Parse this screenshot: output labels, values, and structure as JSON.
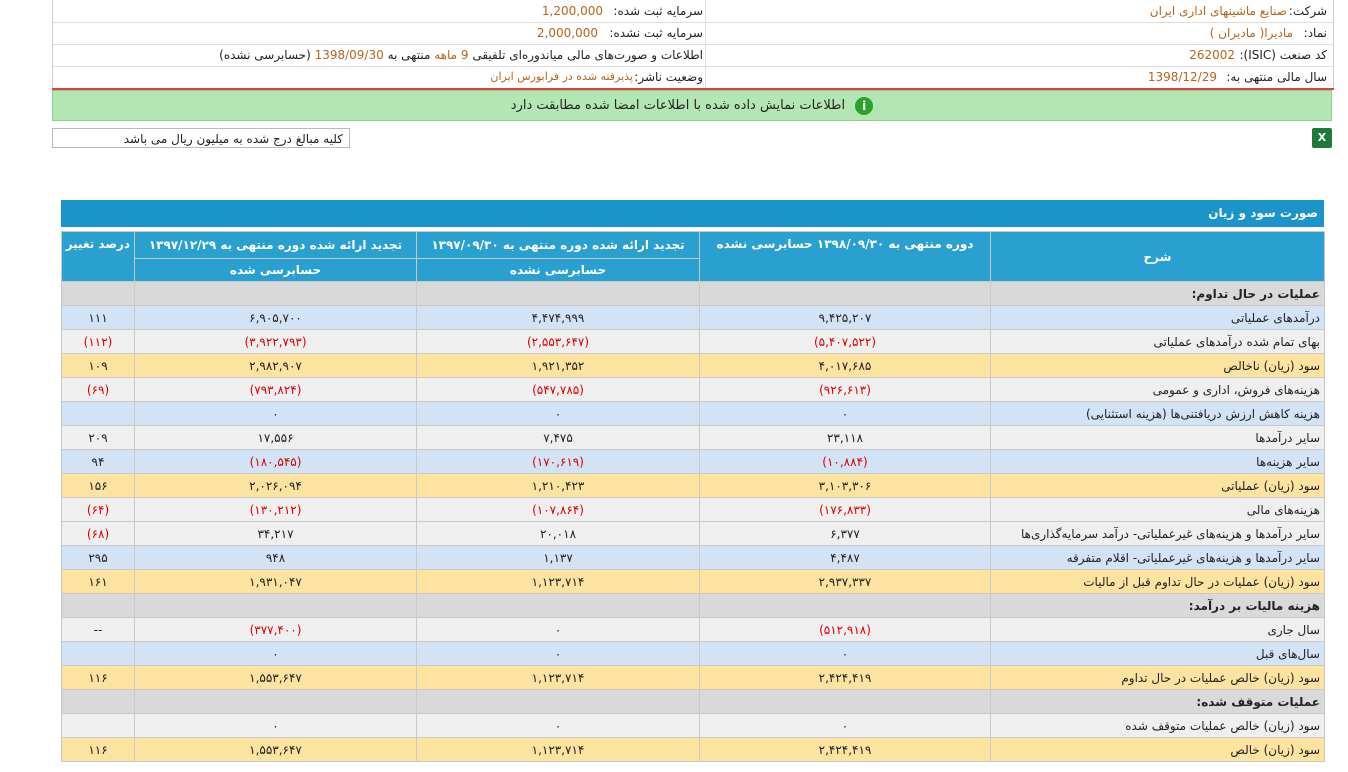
{
  "company": {
    "company_label": "شرکت:",
    "company_value": "صنایع ماشینهای اداری ایران",
    "registered_capital_label": "سرمایه ثبت شده:",
    "registered_capital_value": "1,200,000",
    "symbol_label": "نماد:",
    "symbol_value": "مادیرا( مادیران )",
    "unregistered_capital_label": "سرمایه ثبت نشده:",
    "unregistered_capital_value": "2,000,000",
    "isic_label": "کد صنعت (ISIC):",
    "isic_value": "262002",
    "report_desc_prefix": "اطلاعات و صورت‌های مالی میاندوره‌ای تلفیقی",
    "report_months": "9 ماهه",
    "report_ending": "منتهی به",
    "report_date": "1398/09/30",
    "report_status": "(حسابرسی نشده)",
    "fiscal_year_label": "سال مالی منتهی به:",
    "fiscal_year_value": "1398/12/29",
    "publisher_status_label": "وضعیت ناشر:",
    "publisher_status_value": "پذیرفته شده در فرابورس ایران"
  },
  "notice": {
    "text": "اطلاعات نمایش داده شده با اطلاعات امضا شده مطابقت دارد",
    "icon": "info-icon"
  },
  "amount_note": "کلیه مبالغ درج شده به میلیون ریال می باشد",
  "excel_icon": "excel-icon",
  "table": {
    "title": "صورت سود و زیان",
    "headers": {
      "desc": "شرح",
      "col1_top": "دوره منتهی به ۱۳۹۸/۰۹/۳۰ حسابرسی نشده",
      "col2_top": "تجدید ارائه شده دوره منتهی به ۱۳۹۷/۰۹/۳۰",
      "col2_bottom": "حسابرسی نشده",
      "col3_top": "تجدید ارائه شده دوره منتهی به ۱۳۹۷/۱۲/۲۹",
      "col3_bottom": "حسابرسی شده",
      "col4": "درصد تغییر"
    },
    "rows": [
      {
        "style": "section",
        "desc": "عملیات در حال تداوم:",
        "c1": "",
        "c2": "",
        "c3": "",
        "c4": ""
      },
      {
        "style": "blue",
        "desc": "درآمدهای عملیاتی",
        "c1": "۹,۴۲۵,۲۰۷",
        "c2": "۴,۴۷۴,۹۹۹",
        "c3": "۶,۹۰۵,۷۰۰",
        "c4": "۱۱۱"
      },
      {
        "style": "white",
        "desc": "بهای تمام شده درآمدهای عملیاتی",
        "c1": "(۵,۴۰۷,۵۲۲)",
        "c2": "(۲,۵۵۳,۶۴۷)",
        "c3": "(۳,۹۲۲,۷۹۳)",
        "c4": "(۱۱۲)"
      },
      {
        "style": "orange",
        "desc": "سود (زیان) ناخالص",
        "c1": "۴,۰۱۷,۶۸۵",
        "c2": "۱,۹۲۱,۳۵۲",
        "c3": "۲,۹۸۲,۹۰۷",
        "c4": "۱۰۹"
      },
      {
        "style": "white",
        "desc": "هزینه‌های فروش، اداری و عمومی",
        "c1": "(۹۲۶,۶۱۳)",
        "c2": "(۵۴۷,۷۸۵)",
        "c3": "(۷۹۳,۸۲۴)",
        "c4": "(۶۹)"
      },
      {
        "style": "blue",
        "desc": "هزینه کاهش ارزش دریافتنی‌ها (هزینه استثنایی)",
        "c1": "۰",
        "c2": "۰",
        "c3": "۰",
        "c4": ""
      },
      {
        "style": "white",
        "desc": "سایر درآمدها",
        "c1": "۲۳,۱۱۸",
        "c2": "۷,۴۷۵",
        "c3": "۱۷,۵۵۶",
        "c4": "۲۰۹"
      },
      {
        "style": "blue",
        "desc": "سایر هزینه‌ها",
        "c1": "(۱۰,۸۸۴)",
        "c2": "(۱۷۰,۶۱۹)",
        "c3": "(۱۸۰,۵۴۵)",
        "c4": "۹۴"
      },
      {
        "style": "orange",
        "desc": "سود (زیان) عملیاتی",
        "c1": "۳,۱۰۳,۳۰۶",
        "c2": "۱,۲۱۰,۴۲۳",
        "c3": "۲,۰۲۶,۰۹۴",
        "c4": "۱۵۶"
      },
      {
        "style": "white",
        "desc": "هزینه‌های مالی",
        "c1": "(۱۷۶,۸۳۳)",
        "c2": "(۱۰۷,۸۶۴)",
        "c3": "(۱۳۰,۲۱۲)",
        "c4": "(۶۴)"
      },
      {
        "style": "white",
        "desc": "سایر درآمدها و هزینه‌های غیرعملیاتی- درآمد سرمایه‌گذاری‌ها",
        "c1": "۶,۳۷۷",
        "c2": "۲۰,۰۱۸",
        "c3": "۳۴,۲۱۷",
        "c4": "(۶۸)"
      },
      {
        "style": "blue",
        "desc": "سایر درآمدها و هزینه‌های غیرعملیاتی- اقلام متفرقه",
        "c1": "۴,۴۸۷",
        "c2": "۱,۱۳۷",
        "c3": "۹۴۸",
        "c4": "۲۹۵"
      },
      {
        "style": "orange",
        "desc": "سود (زیان) عملیات در حال تداوم قبل از مالیات",
        "c1": "۲,۹۳۷,۳۳۷",
        "c2": "۱,۱۲۳,۷۱۴",
        "c3": "۱,۹۳۱,۰۴۷",
        "c4": "۱۶۱"
      },
      {
        "style": "section",
        "desc": "هزینه مالیات بر درآمد:",
        "c1": "",
        "c2": "",
        "c3": "",
        "c4": ""
      },
      {
        "style": "white",
        "desc": "سال جاری",
        "c1": "(۵۱۲,۹۱۸)",
        "c2": "۰",
        "c3": "(۳۷۷,۴۰۰)",
        "c4": "--"
      },
      {
        "style": "blue",
        "desc": "سال‌های قبل",
        "c1": "۰",
        "c2": "۰",
        "c3": "۰",
        "c4": ""
      },
      {
        "style": "orange",
        "desc": "سود (زیان) خالص عملیات در حال تداوم",
        "c1": "۲,۴۲۴,۴۱۹",
        "c2": "۱,۱۲۳,۷۱۴",
        "c3": "۱,۵۵۳,۶۴۷",
        "c4": "۱۱۶"
      },
      {
        "style": "section",
        "desc": "عملیات متوقف شده:",
        "c1": "",
        "c2": "",
        "c3": "",
        "c4": ""
      },
      {
        "style": "white",
        "desc": "سود (زیان) خالص عملیات متوقف شده",
        "c1": "۰",
        "c2": "۰",
        "c3": "۰",
        "c4": ""
      },
      {
        "style": "orange",
        "desc": "سود (زیان) خالص",
        "c1": "۲,۴۲۴,۴۱۹",
        "c2": "۱,۱۲۳,۷۱۴",
        "c3": "۱,۵۵۳,۶۴۷",
        "c4": "۱۱۶"
      }
    ]
  }
}
